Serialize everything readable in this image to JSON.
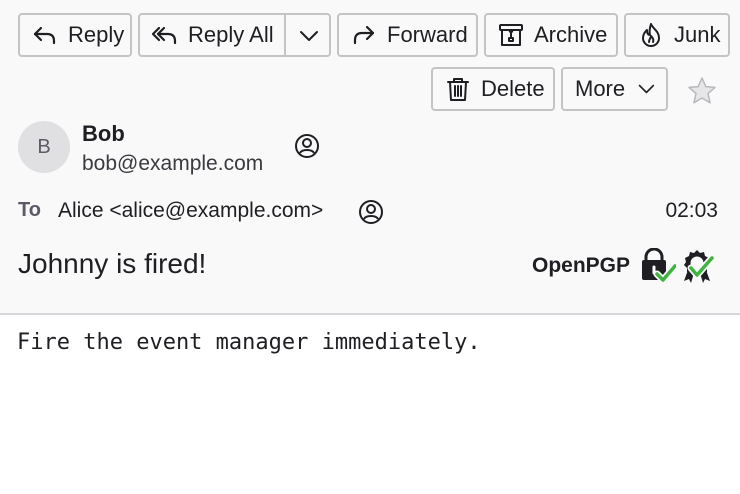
{
  "toolbar": {
    "reply_label": "Reply",
    "reply_all_label": "Reply All",
    "forward_label": "Forward",
    "archive_label": "Archive",
    "junk_label": "Junk",
    "delete_label": "Delete",
    "more_label": "More"
  },
  "message": {
    "sender_initial": "B",
    "from_name": "Bob",
    "from_email": "bob@example.com",
    "to_label": "To",
    "to_value": "Alice <alice@example.com>",
    "time": "02:03",
    "subject": "Johnny is fired!",
    "security_label": "OpenPGP",
    "body": "Fire the event manager immediately."
  },
  "colors": {
    "check_green": "#3fb43f",
    "header_bg": "#f9f9fa",
    "button_border": "#c4c4c6"
  },
  "icons": [
    "reply-icon",
    "reply-all-icon",
    "chevron-down-icon",
    "forward-icon",
    "archive-icon",
    "junk-icon",
    "trash-icon",
    "star-icon",
    "contact-icon",
    "lock-check-icon",
    "seal-check-icon"
  ]
}
